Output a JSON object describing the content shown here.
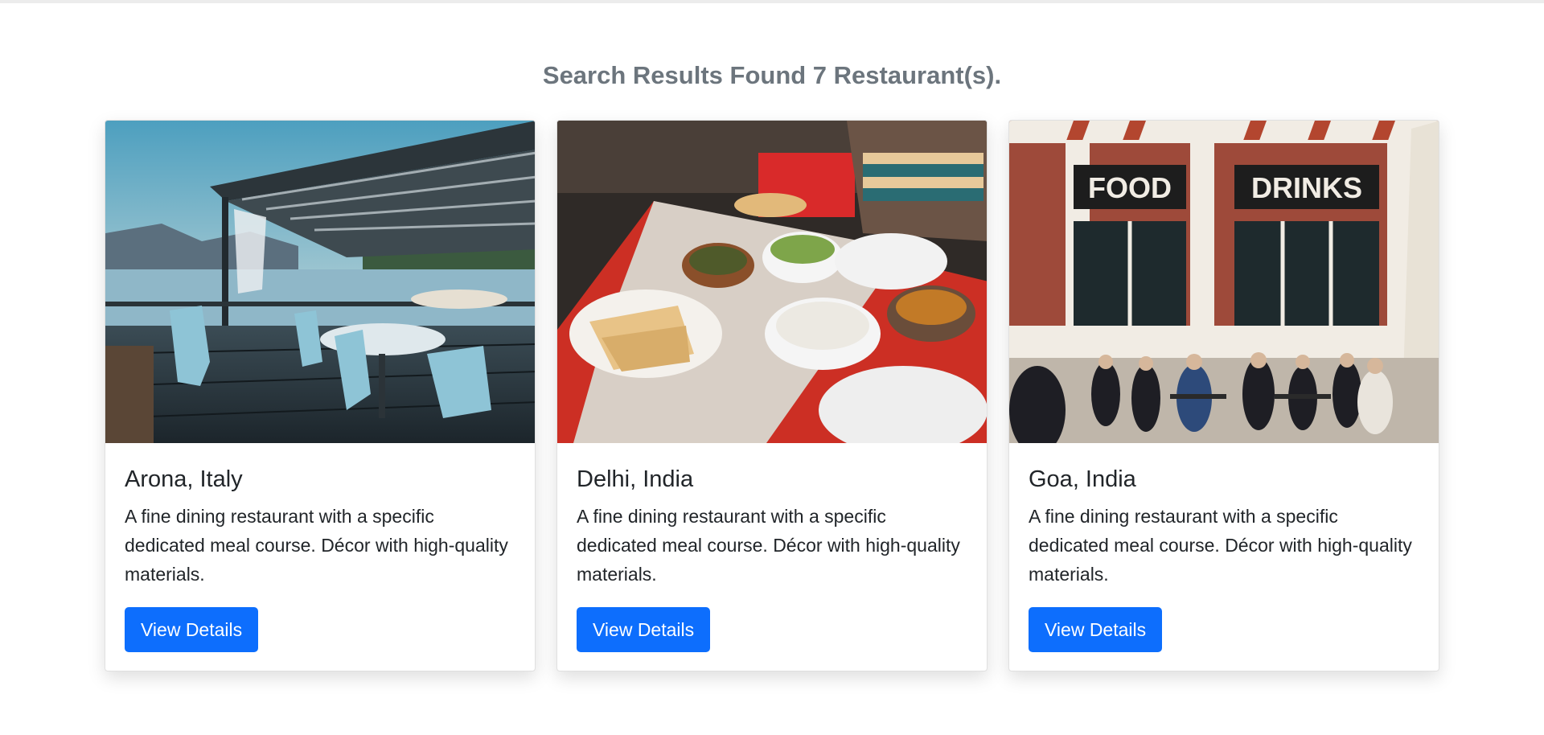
{
  "header": {
    "title": "Search Results",
    "summary": "Found 7 Restaurant(s)."
  },
  "restaurants": [
    {
      "name": "Arona, Italy",
      "description": "A fine dining restaurant with a specific dedicated meal course. Décor with high-quality materials.",
      "button_label": "View Details",
      "image_alt": "lakeside terrace restaurant"
    },
    {
      "name": "Delhi, India",
      "description": "A fine dining restaurant with a specific dedicated meal course. Décor with high-quality materials.",
      "button_label": "View Details",
      "image_alt": "indian food on table"
    },
    {
      "name": "Goa, India",
      "description": "A fine dining restaurant with a specific dedicated meal course. Décor with high-quality materials.",
      "button_label": "View Details",
      "image_alt": "restaurant storefront with outdoor seating",
      "sign_left": "FOOD",
      "sign_right": "DRINKS"
    }
  ],
  "colors": {
    "primary": "#0d6efd",
    "muted_heading": "#6c757d",
    "body_text": "#212529"
  }
}
